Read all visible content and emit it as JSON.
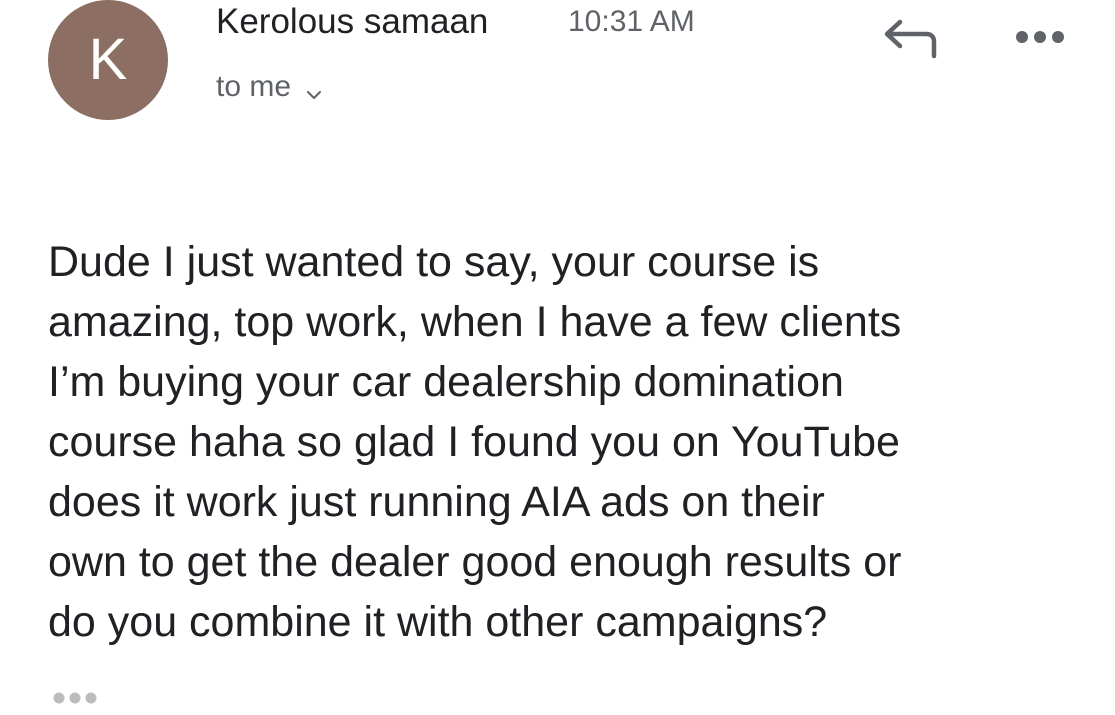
{
  "sender": {
    "avatar_letter": "K",
    "avatar_color": "#8d6e63",
    "name": "Kerolous samaan",
    "time": "10:31 AM"
  },
  "recipients": {
    "label": "to me",
    "icon": "chevron-down-icon"
  },
  "actions": {
    "reply_icon": "reply-icon",
    "more_icon": "more-options-icon"
  },
  "message": {
    "body": "Dude I just wanted to say, your course is\namazing, top work, when I have a few clients\nI’m buying your car dealership domination\ncourse haha so glad I found you on YouTube\n does it work just running AIA ads on their\nown to get the dealer good enough results or\ndo you combine it with other campaigns?",
    "trimmed_icon": "show-trimmed-content-icon"
  },
  "colors": {
    "text": "#202124",
    "secondary_text": "#5f6368",
    "icon": "#5f6368",
    "trimmed_dots": "#bdbdbd"
  }
}
